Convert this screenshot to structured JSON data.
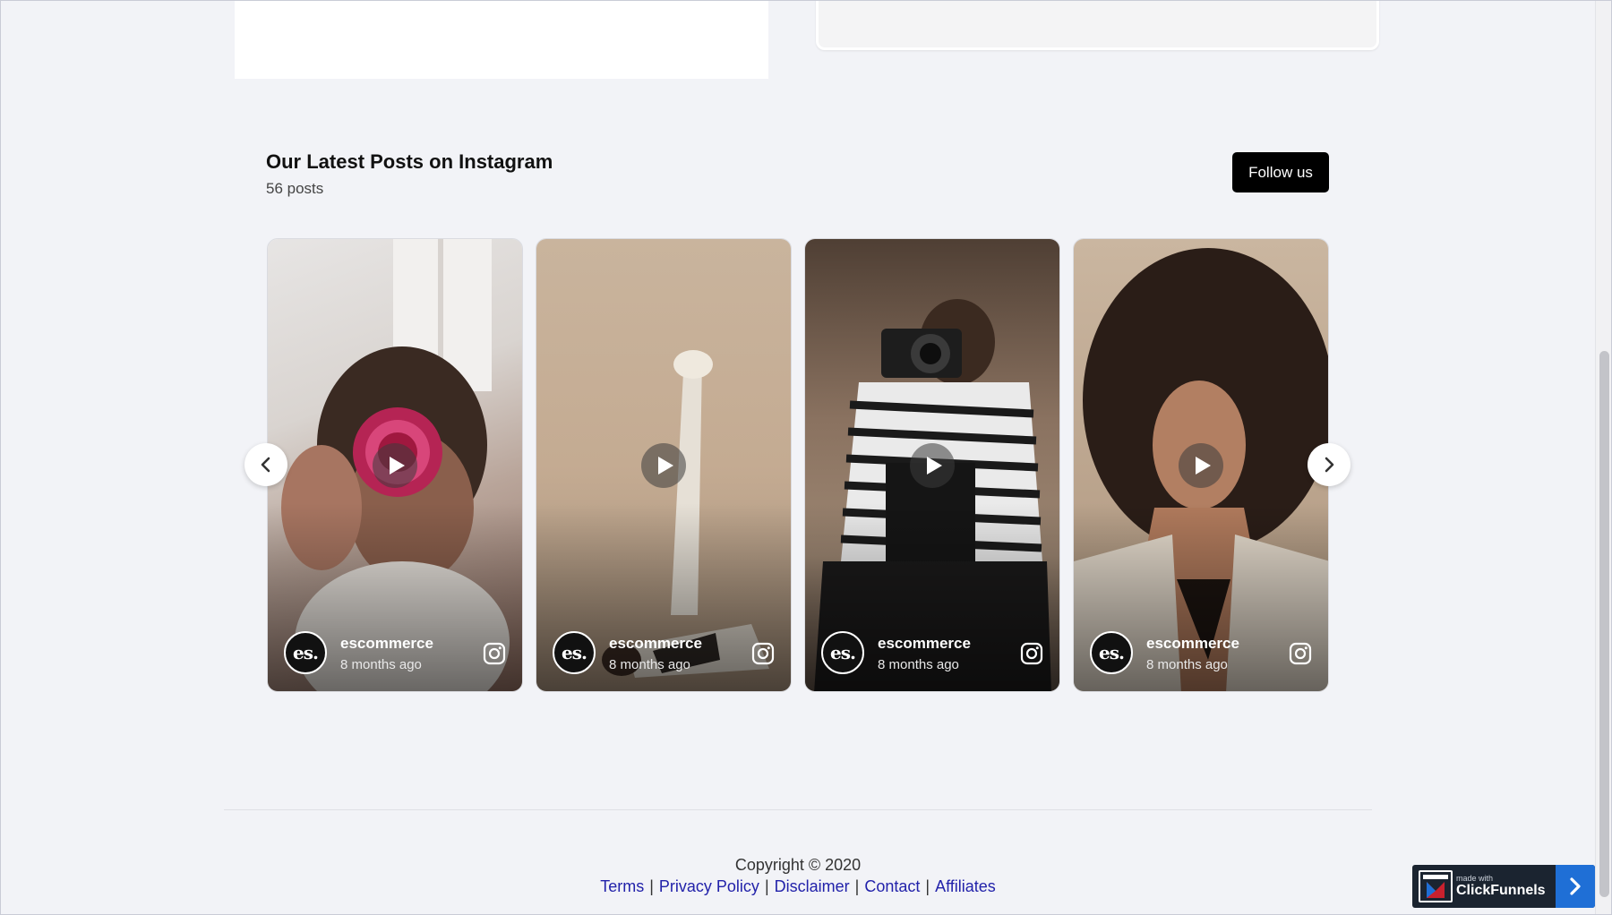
{
  "instagram": {
    "title": "Our Latest Posts on Instagram",
    "post_count": "56 posts",
    "follow_label": "Follow us",
    "posts": [
      {
        "username": "escommerce",
        "time": "8 months ago",
        "avatar_text": "es."
      },
      {
        "username": "escommerce",
        "time": "8 months ago",
        "avatar_text": "es."
      },
      {
        "username": "escommerce",
        "time": "8 months ago",
        "avatar_text": "es."
      },
      {
        "username": "escommerce",
        "time": "8 months ago",
        "avatar_text": "es."
      }
    ]
  },
  "footer": {
    "copyright": "Copyright © 2020",
    "links": [
      "Terms",
      "Privacy Policy",
      "Disclaimer",
      "Contact",
      "Affiliates"
    ],
    "separator": "|",
    "link_color": "#2222aa"
  },
  "badge": {
    "small_text": "made with",
    "brand": "ClickFunnels",
    "accent": "#1f6fd6"
  },
  "icons": [
    "chevron-left-icon",
    "chevron-right-icon",
    "play-icon",
    "instagram-icon"
  ]
}
